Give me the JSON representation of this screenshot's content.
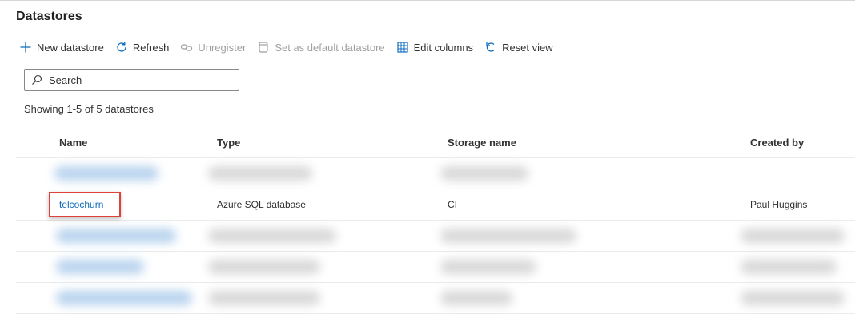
{
  "page": {
    "title": "Datastores"
  },
  "toolbar": {
    "new_datastore": "New datastore",
    "refresh": "Refresh",
    "unregister": "Unregister",
    "set_default": "Set as default datastore",
    "edit_columns": "Edit columns",
    "reset_view": "Reset view"
  },
  "search": {
    "placeholder": "Search",
    "value": ""
  },
  "status": {
    "showing": "Showing 1-5 of 5 datastores"
  },
  "table": {
    "columns": [
      "Name",
      "Type",
      "Storage name",
      "Created by"
    ],
    "rows": [
      {
        "name": "",
        "type": "",
        "storage": "",
        "created_by": "",
        "redacted": true
      },
      {
        "name": "telcochurn",
        "type": "Azure SQL database",
        "storage": "CI",
        "created_by": "Paul Huggins",
        "redacted": false
      },
      {
        "name": "",
        "type": "",
        "storage": "",
        "created_by": "",
        "redacted": true
      },
      {
        "name": "",
        "type": "",
        "storage": "",
        "created_by": "",
        "redacted": true
      },
      {
        "name": "",
        "type": "",
        "storage": "",
        "created_by": "",
        "redacted": true
      }
    ]
  },
  "colors": {
    "link": "#0f6cbd",
    "highlight_border": "#e0403a",
    "disabled_text": "#a19f9d"
  },
  "icons": {
    "new_datastore": "plus-icon",
    "refresh": "refresh-icon",
    "unregister": "unlink-icon",
    "set_default": "database-icon",
    "edit_columns": "table-columns-icon",
    "reset_view": "undo-icon",
    "search": "search-icon"
  }
}
